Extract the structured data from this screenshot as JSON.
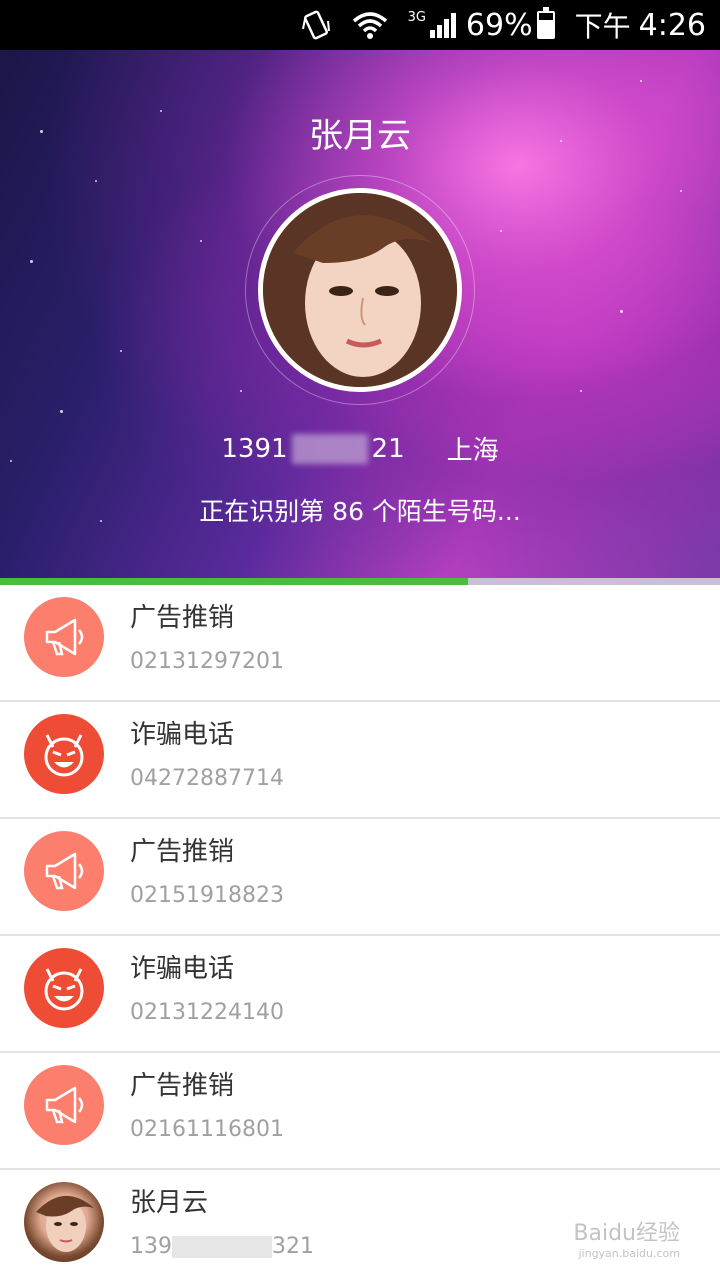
{
  "status_bar": {
    "network": "3G",
    "battery_percent_text": "69%",
    "battery_level": 0.69,
    "time_prefix": "下午",
    "time": "4:26"
  },
  "caller": {
    "name": "张月云",
    "number_prefix": "1391",
    "number_suffix": "21",
    "location": "上海",
    "scan_text": "正在识别第 86 个陌生号码..."
  },
  "progress": {
    "fraction": 0.65
  },
  "list": [
    {
      "type": "ad",
      "icon": "megaphone-icon",
      "title": "广告推销",
      "number": "02131297201"
    },
    {
      "type": "fraud",
      "icon": "devil-icon",
      "title": "诈骗电话",
      "number": "04272887714"
    },
    {
      "type": "ad",
      "icon": "megaphone-icon",
      "title": "广告推销",
      "number": "02151918823"
    },
    {
      "type": "fraud",
      "icon": "devil-icon",
      "title": "诈骗电话",
      "number": "02131224140"
    },
    {
      "type": "ad",
      "icon": "megaphone-icon",
      "title": "广告推销",
      "number": "02161116801"
    }
  ],
  "last_item": {
    "title": "张月云",
    "number_prefix": "139",
    "number_suffix": "321"
  },
  "watermark": {
    "brand": "Baidu经验",
    "url": "jingyan.baidu.com"
  },
  "colors": {
    "ad": "#fb7f6c",
    "fraud": "#ef4c36",
    "progress": "#4cbc3c"
  }
}
